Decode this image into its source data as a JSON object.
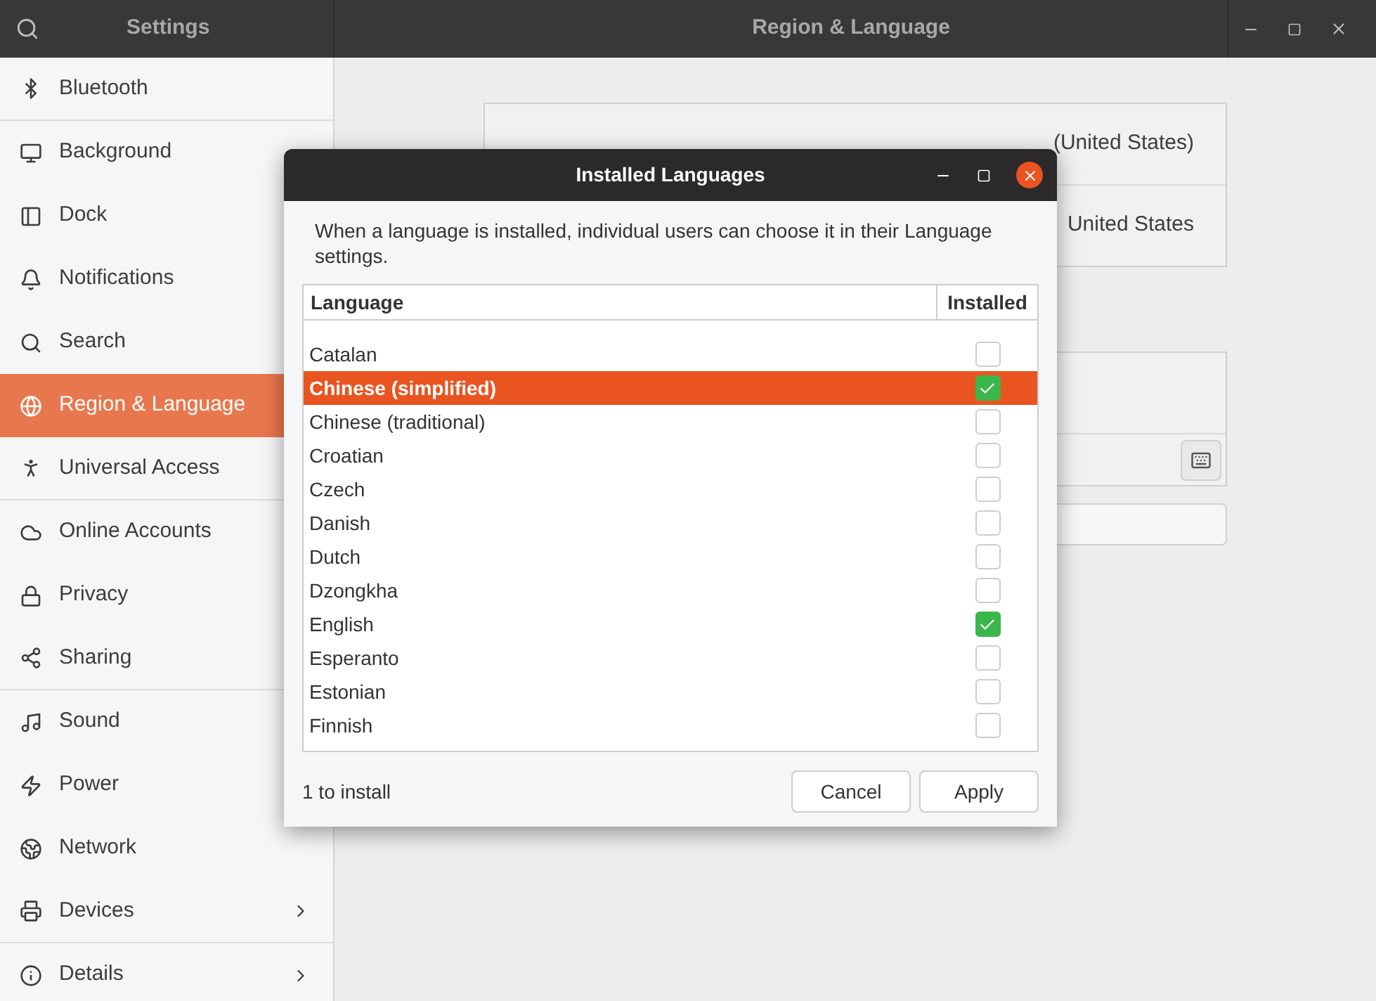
{
  "window": {
    "sidebar_title": "Settings",
    "title": "Region & Language"
  },
  "sidebar": {
    "items": [
      {
        "label": "Bluetooth",
        "kind": "page",
        "selected": false,
        "divider": true
      },
      {
        "label": "Background",
        "kind": "page",
        "selected": false,
        "divider": false
      },
      {
        "label": "Dock",
        "kind": "page",
        "selected": false,
        "divider": false
      },
      {
        "label": "Notifications",
        "kind": "page",
        "selected": false,
        "divider": false
      },
      {
        "label": "Search",
        "kind": "page",
        "selected": false,
        "divider": false
      },
      {
        "label": "Region & Language",
        "kind": "page",
        "selected": true,
        "divider": false
      },
      {
        "label": "Universal Access",
        "kind": "page",
        "selected": false,
        "divider": true
      },
      {
        "label": "Online Accounts",
        "kind": "page",
        "selected": false,
        "divider": false
      },
      {
        "label": "Privacy",
        "kind": "page",
        "selected": false,
        "divider": false
      },
      {
        "label": "Sharing",
        "kind": "page",
        "selected": false,
        "divider": true
      },
      {
        "label": "Sound",
        "kind": "page",
        "selected": false,
        "divider": false
      },
      {
        "label": "Power",
        "kind": "page",
        "selected": false,
        "divider": false
      },
      {
        "label": "Network",
        "kind": "page",
        "selected": false,
        "divider": false
      },
      {
        "label": "Devices",
        "kind": "submenu",
        "selected": false,
        "divider": true
      },
      {
        "label": "Details",
        "kind": "submenu",
        "selected": false,
        "divider": false
      }
    ]
  },
  "region_panel": {
    "language_value": "(United States)",
    "formats_value": "United States"
  },
  "dialog": {
    "title": "Installed Languages",
    "description": "When a language is installed, individual users can choose it in their Language settings.",
    "columns": [
      "Language",
      "Installed"
    ],
    "rows": [
      {
        "language": "Catalan",
        "installed": false,
        "selected": false
      },
      {
        "language": "Chinese (simplified)",
        "installed": true,
        "selected": true
      },
      {
        "language": "Chinese (traditional)",
        "installed": false,
        "selected": false
      },
      {
        "language": "Croatian",
        "installed": false,
        "selected": false
      },
      {
        "language": "Czech",
        "installed": false,
        "selected": false
      },
      {
        "language": "Danish",
        "installed": false,
        "selected": false
      },
      {
        "language": "Dutch",
        "installed": false,
        "selected": false
      },
      {
        "language": "Dzongkha",
        "installed": false,
        "selected": false
      },
      {
        "language": "English",
        "installed": true,
        "selected": false
      },
      {
        "language": "Esperanto",
        "installed": false,
        "selected": false
      },
      {
        "language": "Estonian",
        "installed": false,
        "selected": false
      },
      {
        "language": "Finnish",
        "installed": false,
        "selected": false
      }
    ],
    "status": "1 to install",
    "buttons": [
      "Cancel",
      "Apply"
    ]
  }
}
